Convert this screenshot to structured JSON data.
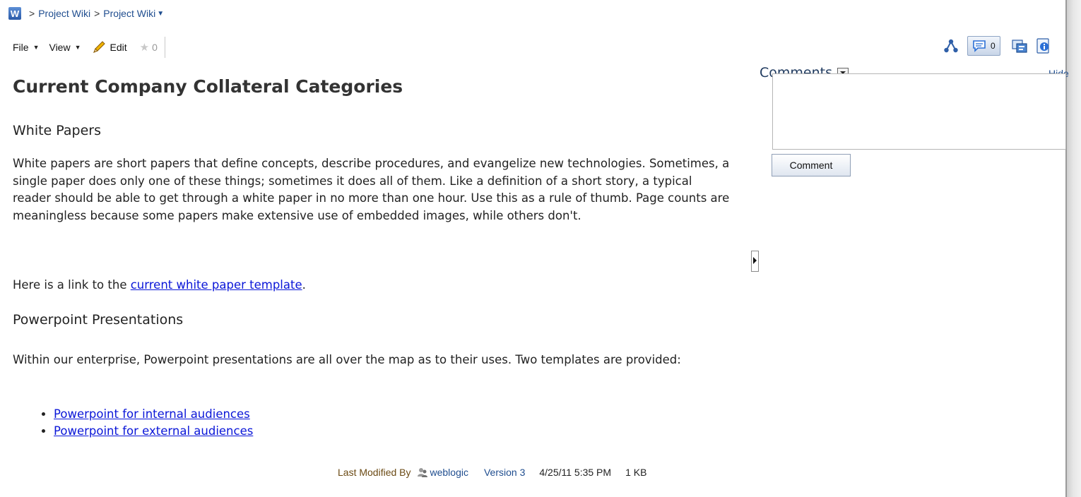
{
  "breadcrumb": {
    "logo_letter": "W",
    "sep": ">",
    "items": [
      "Project Wiki",
      "Project Wiki"
    ]
  },
  "toolbar": {
    "file_label": "File",
    "view_label": "View",
    "edit_label": "Edit",
    "star_count": "0"
  },
  "right_tools": {
    "comment_count": "0"
  },
  "page": {
    "title": "Current Company Collateral Categories",
    "sections": [
      {
        "heading": "White Papers",
        "paragraph": "White papers are short papers that define concepts, describe procedures, and evangelize new technologies. Sometimes, a single paper does only one of these things; sometimes it does all of them. Like a definition of a short story, a typical reader should be able to get through a white paper in no more than one hour. Use this as a rule of thumb. Page counts are meaningless because some papers make extensive use of embedded images, while others don't.",
        "link_prefix": "Here is a link to the ",
        "link_text": "current white paper template",
        "link_suffix": "."
      },
      {
        "heading": "Powerpoint Presentations",
        "paragraph": "Within our enterprise, Powerpoint presentations are all over the map as to their uses. Two templates are provided:",
        "links": [
          "Powerpoint for internal audiences",
          "Powerpoint for external audiences"
        ]
      }
    ]
  },
  "footer": {
    "last_modified_label": "Last Modified By",
    "user": "weblogic",
    "version": "Version 3",
    "date": "4/25/11 5:35 PM",
    "size": "1 KB"
  },
  "comments": {
    "title": "Comments",
    "hide_label": "Hide",
    "button_label": "Comment",
    "input_value": ""
  },
  "colors": {
    "link": "#0a16d8",
    "nav_link": "#1f4d8f",
    "footer_label": "#6b4a14"
  }
}
